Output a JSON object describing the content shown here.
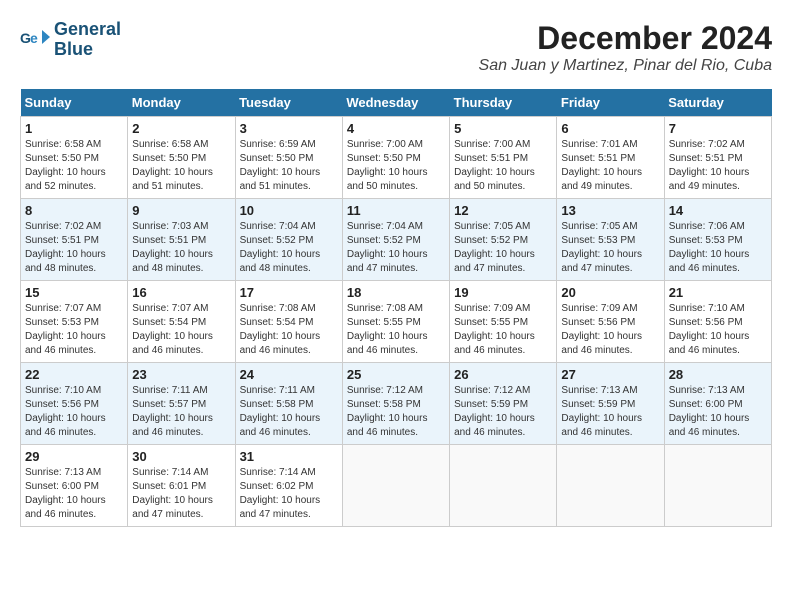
{
  "header": {
    "logo_line1": "General",
    "logo_line2": "Blue",
    "month_title": "December 2024",
    "location": "San Juan y Martinez, Pinar del Rio, Cuba"
  },
  "weekdays": [
    "Sunday",
    "Monday",
    "Tuesday",
    "Wednesday",
    "Thursday",
    "Friday",
    "Saturday"
  ],
  "weeks": [
    [
      {
        "day": "1",
        "sunrise": "6:58 AM",
        "sunset": "5:50 PM",
        "daylight": "10 hours and 52 minutes."
      },
      {
        "day": "2",
        "sunrise": "6:58 AM",
        "sunset": "5:50 PM",
        "daylight": "10 hours and 51 minutes."
      },
      {
        "day": "3",
        "sunrise": "6:59 AM",
        "sunset": "5:50 PM",
        "daylight": "10 hours and 51 minutes."
      },
      {
        "day": "4",
        "sunrise": "7:00 AM",
        "sunset": "5:50 PM",
        "daylight": "10 hours and 50 minutes."
      },
      {
        "day": "5",
        "sunrise": "7:00 AM",
        "sunset": "5:51 PM",
        "daylight": "10 hours and 50 minutes."
      },
      {
        "day": "6",
        "sunrise": "7:01 AM",
        "sunset": "5:51 PM",
        "daylight": "10 hours and 49 minutes."
      },
      {
        "day": "7",
        "sunrise": "7:02 AM",
        "sunset": "5:51 PM",
        "daylight": "10 hours and 49 minutes."
      }
    ],
    [
      {
        "day": "8",
        "sunrise": "7:02 AM",
        "sunset": "5:51 PM",
        "daylight": "10 hours and 48 minutes."
      },
      {
        "day": "9",
        "sunrise": "7:03 AM",
        "sunset": "5:51 PM",
        "daylight": "10 hours and 48 minutes."
      },
      {
        "day": "10",
        "sunrise": "7:04 AM",
        "sunset": "5:52 PM",
        "daylight": "10 hours and 48 minutes."
      },
      {
        "day": "11",
        "sunrise": "7:04 AM",
        "sunset": "5:52 PM",
        "daylight": "10 hours and 47 minutes."
      },
      {
        "day": "12",
        "sunrise": "7:05 AM",
        "sunset": "5:52 PM",
        "daylight": "10 hours and 47 minutes."
      },
      {
        "day": "13",
        "sunrise": "7:05 AM",
        "sunset": "5:53 PM",
        "daylight": "10 hours and 47 minutes."
      },
      {
        "day": "14",
        "sunrise": "7:06 AM",
        "sunset": "5:53 PM",
        "daylight": "10 hours and 46 minutes."
      }
    ],
    [
      {
        "day": "15",
        "sunrise": "7:07 AM",
        "sunset": "5:53 PM",
        "daylight": "10 hours and 46 minutes."
      },
      {
        "day": "16",
        "sunrise": "7:07 AM",
        "sunset": "5:54 PM",
        "daylight": "10 hours and 46 minutes."
      },
      {
        "day": "17",
        "sunrise": "7:08 AM",
        "sunset": "5:54 PM",
        "daylight": "10 hours and 46 minutes."
      },
      {
        "day": "18",
        "sunrise": "7:08 AM",
        "sunset": "5:55 PM",
        "daylight": "10 hours and 46 minutes."
      },
      {
        "day": "19",
        "sunrise": "7:09 AM",
        "sunset": "5:55 PM",
        "daylight": "10 hours and 46 minutes."
      },
      {
        "day": "20",
        "sunrise": "7:09 AM",
        "sunset": "5:56 PM",
        "daylight": "10 hours and 46 minutes."
      },
      {
        "day": "21",
        "sunrise": "7:10 AM",
        "sunset": "5:56 PM",
        "daylight": "10 hours and 46 minutes."
      }
    ],
    [
      {
        "day": "22",
        "sunrise": "7:10 AM",
        "sunset": "5:56 PM",
        "daylight": "10 hours and 46 minutes."
      },
      {
        "day": "23",
        "sunrise": "7:11 AM",
        "sunset": "5:57 PM",
        "daylight": "10 hours and 46 minutes."
      },
      {
        "day": "24",
        "sunrise": "7:11 AM",
        "sunset": "5:58 PM",
        "daylight": "10 hours and 46 minutes."
      },
      {
        "day": "25",
        "sunrise": "7:12 AM",
        "sunset": "5:58 PM",
        "daylight": "10 hours and 46 minutes."
      },
      {
        "day": "26",
        "sunrise": "7:12 AM",
        "sunset": "5:59 PM",
        "daylight": "10 hours and 46 minutes."
      },
      {
        "day": "27",
        "sunrise": "7:13 AM",
        "sunset": "5:59 PM",
        "daylight": "10 hours and 46 minutes."
      },
      {
        "day": "28",
        "sunrise": "7:13 AM",
        "sunset": "6:00 PM",
        "daylight": "10 hours and 46 minutes."
      }
    ],
    [
      {
        "day": "29",
        "sunrise": "7:13 AM",
        "sunset": "6:00 PM",
        "daylight": "10 hours and 46 minutes."
      },
      {
        "day": "30",
        "sunrise": "7:14 AM",
        "sunset": "6:01 PM",
        "daylight": "10 hours and 47 minutes."
      },
      {
        "day": "31",
        "sunrise": "7:14 AM",
        "sunset": "6:02 PM",
        "daylight": "10 hours and 47 minutes."
      },
      null,
      null,
      null,
      null
    ]
  ]
}
